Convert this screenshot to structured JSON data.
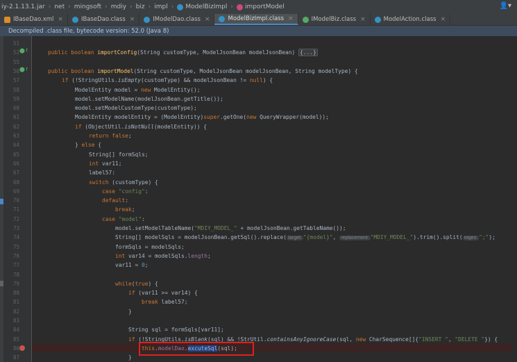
{
  "breadcrumb": {
    "items": [
      "iy-2.1.13.1.jar",
      "net",
      "mingsoft",
      "mdiy",
      "biz",
      "impl",
      "ModelBizImpl",
      "importModel"
    ],
    "user_icon": "user-icon"
  },
  "tabs": [
    {
      "label": "IBaseDao.xml",
      "color": "#d98e2b",
      "active": false
    },
    {
      "label": "IBaseDao.class",
      "color": "#3592c4",
      "active": false
    },
    {
      "label": "IModelDao.class",
      "color": "#3592c4",
      "active": false
    },
    {
      "label": "ModelBizImpl.class",
      "color": "#3592c4",
      "active": true
    },
    {
      "label": "IModelBiz.class",
      "color": "#3592c4",
      "active": false
    },
    {
      "label": "ModelAction.class",
      "color": "#3592c4",
      "active": false
    }
  ],
  "banner": "Decompiled .class file, bytecode version: 52.0 (Java 8)",
  "line_numbers": [
    "51",
    "52",
    "55",
    "56",
    "57",
    "58",
    "59",
    "60",
    "61",
    "62",
    "63",
    "64",
    "65",
    "66",
    "67",
    "68",
    "69",
    "70",
    "71",
    "72",
    "73",
    "74",
    "75",
    "76",
    "77",
    "78",
    "79",
    "80",
    "81",
    "82",
    "83",
    "84",
    "85",
    "86",
    "87"
  ],
  "code": {
    "l51": "",
    "l52": [
      "public boolean ",
      "importConfig",
      "(String customType, ModelJsonBean modelJsonBean) ",
      "{...}"
    ],
    "l55": "",
    "l56": [
      "public boolean ",
      "importModel",
      "(String customType, ModelJsonBean modelJsonBean, String modelType) {"
    ],
    "l57": [
      "if ",
      "(!StringUtils.",
      "isEmpty",
      "(customType) && modelJsonBean != ",
      "null",
      ") {"
    ],
    "l58": [
      "ModelEntity model = ",
      "new ",
      "ModelEntity();"
    ],
    "l59": "model.setModelName(modelJsonBean.getTitle());",
    "l60": "model.setModelCustomType(customType);",
    "l61": [
      "ModelEntity modelEntity = (ModelEntity)",
      "super",
      ".getOne(",
      "new ",
      "QueryWrapper(model));"
    ],
    "l62": [
      "if ",
      "(ObjectUtil.",
      "isNotNull",
      "(modelEntity)) {"
    ],
    "l63": [
      "return false",
      ";"
    ],
    "l64": [
      "} ",
      "else ",
      "{"
    ],
    "l65": "String[] formSqls;",
    "l66": [
      "int ",
      "var11;"
    ],
    "l67": "label57:",
    "l68": [
      "switch ",
      "(customType) {"
    ],
    "l69": [
      "case ",
      "\"config\"",
      ":"
    ],
    "l70": [
      "default",
      ":"
    ],
    "l71": [
      "break",
      ";"
    ],
    "l72": [
      "case ",
      "\"model\"",
      ":"
    ],
    "l73": [
      "model.setModelTableName(",
      "\"MDIY_MODEL_\" ",
      "+ modelJsonBean.getTableName());"
    ],
    "l74": [
      "String[] modelSqls = modelJsonBean.getSql().replace(",
      "target:",
      "\"{model}\"",
      ", ",
      "replacement:",
      "\"MDIY_MODEL_\"",
      ").trim().split(",
      "regex:",
      "\";\"",
      ");"
    ],
    "l75": "formSqls = modelSqls;",
    "l76": [
      "int ",
      "var14 = modelSqls.",
      "length",
      ";"
    ],
    "l77": [
      "var11 = ",
      "0",
      ";"
    ],
    "l78": "",
    "l79": [
      "while",
      "(",
      "true",
      ") {"
    ],
    "l80": [
      "if ",
      "(var11 >= var14) {"
    ],
    "l81": [
      "break ",
      "label57;"
    ],
    "l82": "}",
    "l83": "",
    "l84": "String sql = formSqls[var11];",
    "l85": [
      "if ",
      "(!StringUtils.",
      "isBlank",
      "(sql) && !StrUtil.",
      "containsAnyIgnoreCase",
      "(sql, ",
      "new ",
      "CharSequence[]{",
      "\"INSERT \"",
      ", ",
      "\"DELETE \"",
      "}) {"
    ],
    "l86": [
      "this",
      ".",
      "modelDao",
      ".",
      "excuteSql",
      "(sql);"
    ],
    "l87": "}"
  }
}
